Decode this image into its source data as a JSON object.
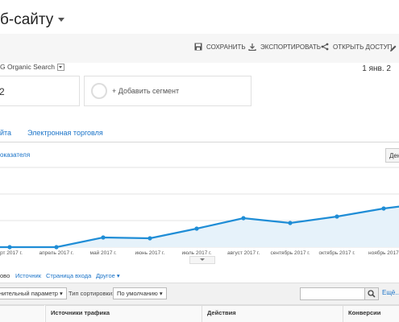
{
  "header": {
    "title": "б-сайту"
  },
  "toolbar": {
    "save_label": "СОХРАНИТЬ",
    "export_label": "ЭКСПОРТИРОВАТЬ",
    "share_label": "ОТКРЫТЬ ДОСТУП"
  },
  "segment": {
    "label": "G Organic Search",
    "value": "2",
    "add_label": "+ Добавить сегмент",
    "date": "1 янв. 2"
  },
  "tabs": [
    "йта",
    "Электронная торговля"
  ],
  "chart_controls": {
    "metric_link": "оказателя",
    "period_button": "Ден"
  },
  "chart_data": {
    "type": "area",
    "categories": [
      "рт 2017 г.",
      "апрель 2017 г.",
      "май 2017 г.",
      "июнь 2017 г.",
      "июль 2017 г.",
      "август 2017 г.",
      "сентябрь 2017 г.",
      "октябрь 2017 г.",
      "ноябрь 2017"
    ],
    "x": [
      0,
      1,
      2,
      3,
      4,
      5,
      6,
      7,
      8,
      8.55
    ],
    "values": [
      0,
      0,
      12,
      11,
      23,
      36,
      30,
      38,
      48,
      52
    ],
    "ylim": [
      0,
      100
    ],
    "grid": true,
    "line_color": "#1f8dd6",
    "fill_color": "#e6f2fa"
  },
  "table_tabs": {
    "first": "ово",
    "source": "Источник",
    "landing": "Страница входа",
    "other": "Другое"
  },
  "controls": {
    "secondary_param": "нительный параметр",
    "sort_label": "Тип сортировки:",
    "sort_value": "По умолчанию",
    "more": "Ещё..."
  },
  "table": {
    "columns": [
      "Источники трафика",
      "Действия",
      "Конверсии"
    ]
  }
}
